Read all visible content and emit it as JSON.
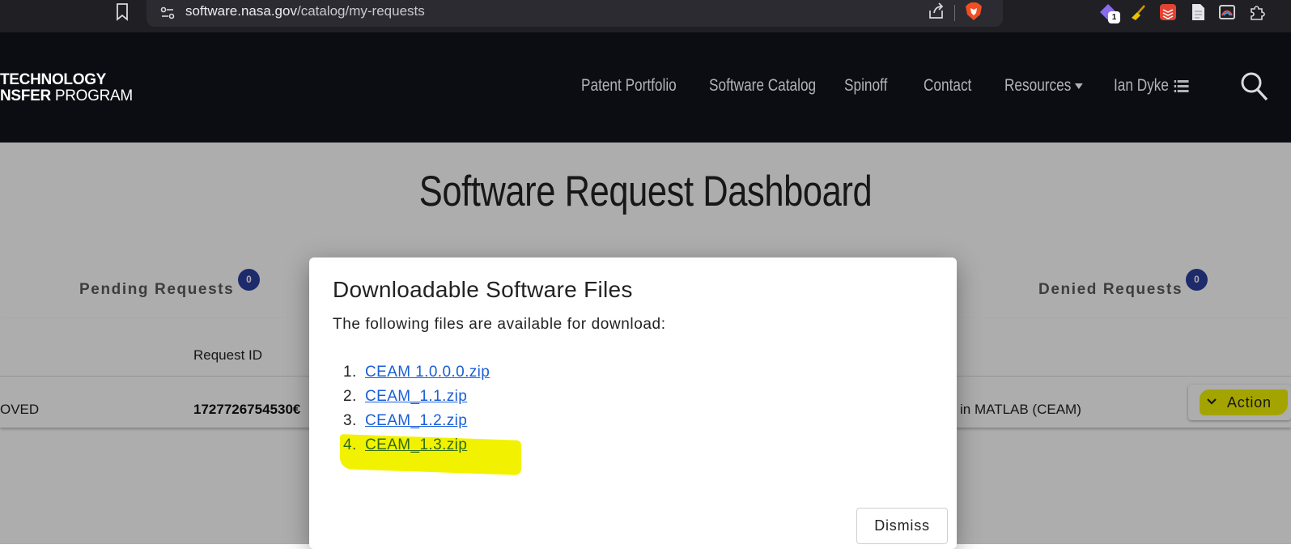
{
  "browser": {
    "url_host": "software.nasa.gov",
    "url_path": "/catalog/my-requests",
    "extension_badge": "1"
  },
  "header": {
    "logo_line1": "TECHNOLOGY",
    "logo_line2_bold": "NSFER",
    "logo_line2_light": " PROGRAM",
    "nav": [
      "Patent Portfolio",
      "Software Catalog",
      "Spinoff",
      "Contact",
      "Resources",
      "Ian Dyke"
    ]
  },
  "page": {
    "title": "Software Request Dashboard",
    "tabs": {
      "pending": {
        "label": "Pending Requests",
        "count": "0"
      },
      "denied": {
        "label": "Denied Requests",
        "count": "0"
      }
    },
    "table": {
      "header_request_id": "Request ID",
      "row": {
        "status": "OVED",
        "request_id": "1727726754530€",
        "name": "in MATLAB (CEAM)",
        "action_label": "Action"
      }
    }
  },
  "modal": {
    "title": "Downloadable Software Files",
    "intro": "The following files are available for download:",
    "files": [
      {
        "num": "1.",
        "name": "CEAM 1.0.0.0.zip"
      },
      {
        "num": "2.",
        "name": "CEAM_1.1.zip"
      },
      {
        "num": "3.",
        "name": "CEAM_1.2.zip"
      },
      {
        "num": "4.",
        "name": "CEAM_1.3.zip"
      }
    ],
    "dismiss_label": "Dismiss"
  },
  "colors": {
    "highlight": "#f2f200",
    "badge": "#2c3e9e",
    "link": "#1a5fd6",
    "header_bg": "#0c0d12"
  }
}
